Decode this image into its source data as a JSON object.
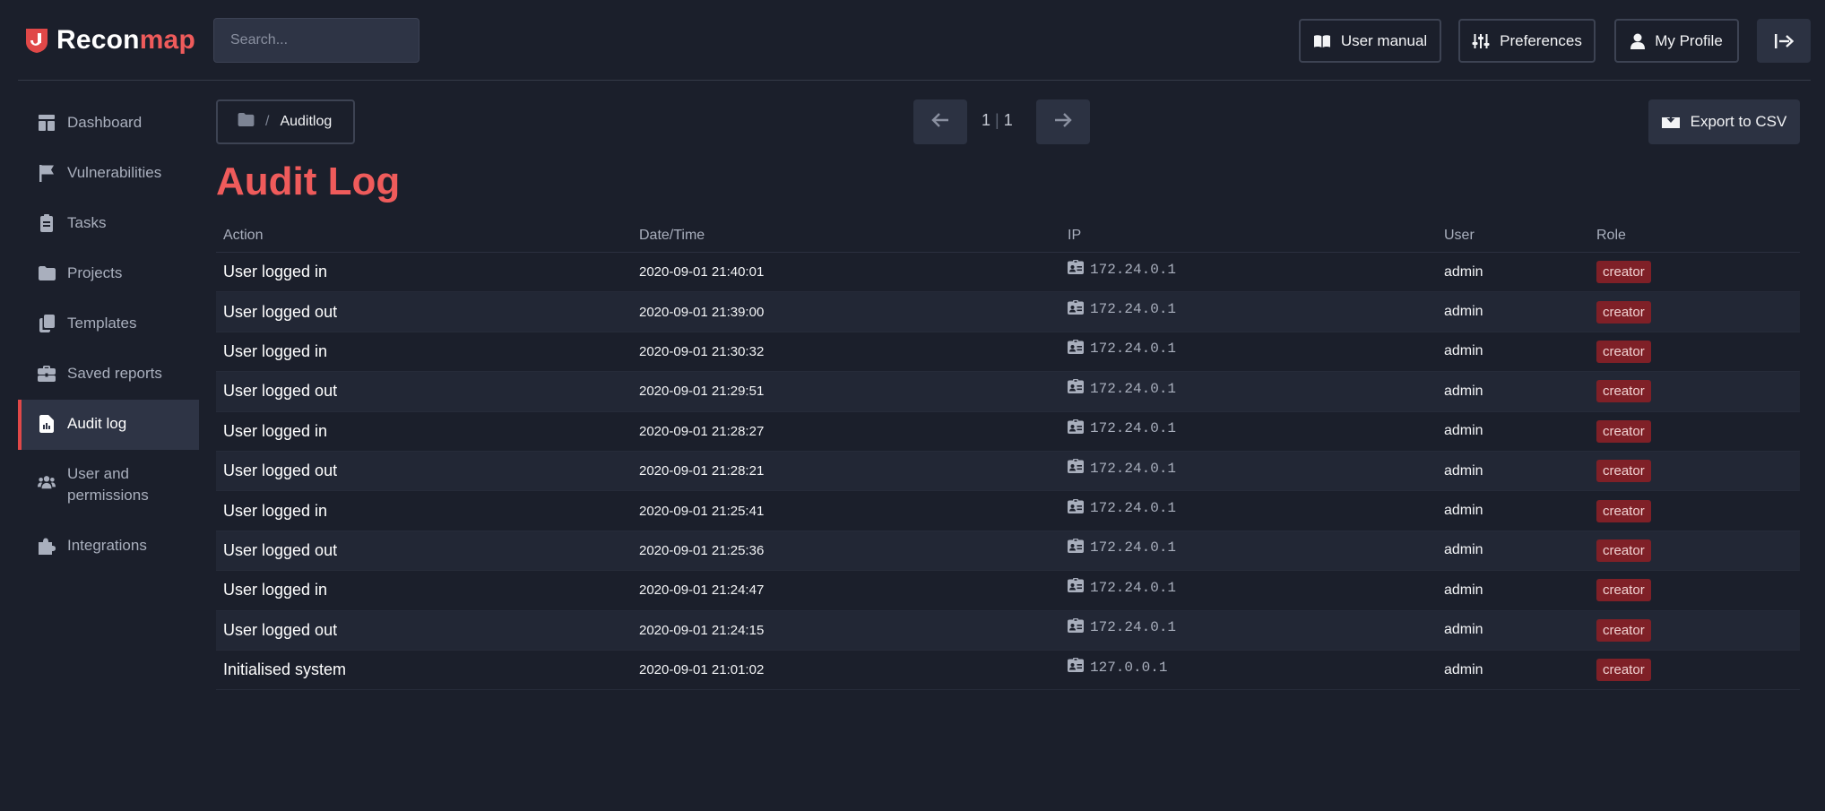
{
  "app": {
    "name_main": "Recon",
    "name_accent": "map"
  },
  "search": {
    "placeholder": "Search..."
  },
  "header": {
    "user_manual": "User manual",
    "preferences": "Preferences",
    "my_profile": "My Profile",
    "logout_icon": "logout-icon"
  },
  "sidebar": {
    "items": [
      {
        "label": "Dashboard",
        "icon": "dashboard-icon"
      },
      {
        "label": "Vulnerabilities",
        "icon": "flag-icon"
      },
      {
        "label": "Tasks",
        "icon": "clipboard-icon"
      },
      {
        "label": "Projects",
        "icon": "folder-icon"
      },
      {
        "label": "Templates",
        "icon": "copy-icon"
      },
      {
        "label": "Saved reports",
        "icon": "briefcase-icon"
      },
      {
        "label": "Audit log",
        "icon": "file-chart-icon",
        "active": true
      },
      {
        "label": "User and permissions",
        "icon": "users-icon"
      },
      {
        "label": "Integrations",
        "icon": "puzzle-icon"
      }
    ]
  },
  "breadcrumb": {
    "separator": "/",
    "current": "Auditlog"
  },
  "pager": {
    "current": "1",
    "separator": "|",
    "total": "1"
  },
  "export": {
    "label": "Export to CSV"
  },
  "page": {
    "title": "Audit Log"
  },
  "table": {
    "headers": [
      "Action",
      "Date/Time",
      "IP",
      "User",
      "Role"
    ],
    "rows": [
      {
        "action": "User logged in",
        "datetime": "2020-09-01 21:40:01",
        "ip": "172.24.0.1",
        "user": "admin",
        "role": "creator"
      },
      {
        "action": "User logged out",
        "datetime": "2020-09-01 21:39:00",
        "ip": "172.24.0.1",
        "user": "admin",
        "role": "creator"
      },
      {
        "action": "User logged in",
        "datetime": "2020-09-01 21:30:32",
        "ip": "172.24.0.1",
        "user": "admin",
        "role": "creator"
      },
      {
        "action": "User logged out",
        "datetime": "2020-09-01 21:29:51",
        "ip": "172.24.0.1",
        "user": "admin",
        "role": "creator"
      },
      {
        "action": "User logged in",
        "datetime": "2020-09-01 21:28:27",
        "ip": "172.24.0.1",
        "user": "admin",
        "role": "creator"
      },
      {
        "action": "User logged out",
        "datetime": "2020-09-01 21:28:21",
        "ip": "172.24.0.1",
        "user": "admin",
        "role": "creator"
      },
      {
        "action": "User logged in",
        "datetime": "2020-09-01 21:25:41",
        "ip": "172.24.0.1",
        "user": "admin",
        "role": "creator"
      },
      {
        "action": "User logged out",
        "datetime": "2020-09-01 21:25:36",
        "ip": "172.24.0.1",
        "user": "admin",
        "role": "creator"
      },
      {
        "action": "User logged in",
        "datetime": "2020-09-01 21:24:47",
        "ip": "172.24.0.1",
        "user": "admin",
        "role": "creator"
      },
      {
        "action": "User logged out",
        "datetime": "2020-09-01 21:24:15",
        "ip": "172.24.0.1",
        "user": "admin",
        "role": "creator"
      },
      {
        "action": "Initialised system",
        "datetime": "2020-09-01 21:01:02",
        "ip": "127.0.0.1",
        "user": "admin",
        "role": "creator"
      }
    ]
  },
  "colors": {
    "accent": "#ef5b5b",
    "badge": "#7f2027",
    "background": "#1b1f2b"
  }
}
